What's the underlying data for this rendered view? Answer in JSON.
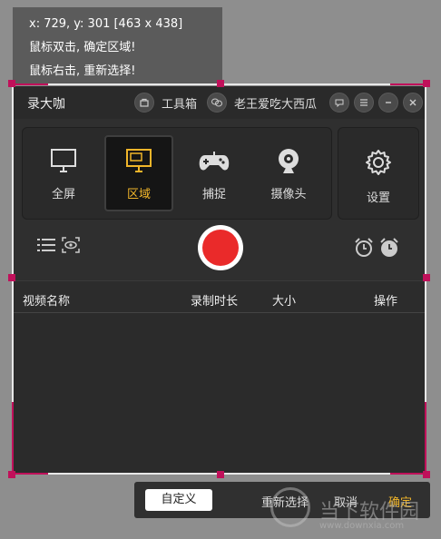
{
  "info": {
    "coords": "x: 729, y: 301  [463 x 438]",
    "line2": "鼠标双击, 确定区域!",
    "line3": "鼠标右击, 重新选择!"
  },
  "app": {
    "title": "录大咖",
    "toolbox_label": "工具箱",
    "user_name": "老王爱吃大西瓜",
    "modes": [
      "全屏",
      "区域",
      "捕捉",
      "摄像头"
    ],
    "active_mode": "区域",
    "settings_label": "设置",
    "table_headers": [
      "视频名称",
      "录制时长",
      "大小",
      "操作"
    ]
  },
  "bottombar": {
    "custom": "自定义",
    "reselect": "重新选择",
    "cancel": "取消",
    "confirm": "确定"
  },
  "watermark": {
    "text": "当下软件园",
    "url": "www.downxia.com"
  },
  "colors": {
    "accent": "#f0b52a",
    "record": "#ea2a2a",
    "handle": "#c0105a"
  }
}
